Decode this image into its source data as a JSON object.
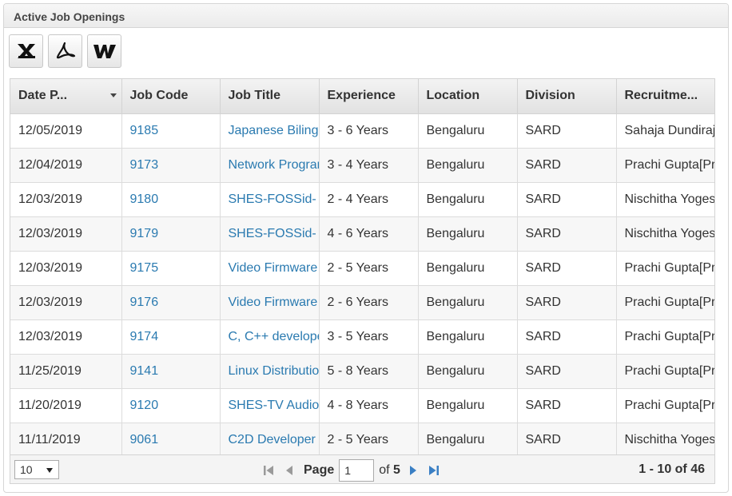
{
  "panel": {
    "title": "Active Job Openings"
  },
  "toolbar": {
    "exports": [
      {
        "name": "excel-export-button",
        "icon": "excel-icon"
      },
      {
        "name": "pdf-export-button",
        "icon": "pdf-icon"
      },
      {
        "name": "word-export-button",
        "icon": "word-icon"
      }
    ]
  },
  "table": {
    "columns": [
      "Date P...",
      "Job Code",
      "Job Title",
      "Experience",
      "Location",
      "Division",
      "Recruitme..."
    ],
    "rows": [
      [
        "12/05/2019",
        "9185",
        "Japanese Bilingual",
        "3 - 6 Years",
        "Bengaluru",
        "SARD",
        "Sahaja Dundiraj"
      ],
      [
        "12/04/2019",
        "9173",
        "Network Programmer",
        "3 - 4 Years",
        "Bengaluru",
        "SARD",
        "Prachi Gupta[Pr"
      ],
      [
        "12/03/2019",
        "9180",
        "SHES-FOSSid-",
        "2 - 4 Years",
        "Bengaluru",
        "SARD",
        "Nischitha Yogesh"
      ],
      [
        "12/03/2019",
        "9179",
        "SHES-FOSSid-",
        "4 - 6 Years",
        "Bengaluru",
        "SARD",
        "Nischitha Yogesh"
      ],
      [
        "12/03/2019",
        "9175",
        "Video Firmware",
        "2 - 5 Years",
        "Bengaluru",
        "SARD",
        "Prachi Gupta[Pr"
      ],
      [
        "12/03/2019",
        "9176",
        "Video Firmware",
        "2 - 6 Years",
        "Bengaluru",
        "SARD",
        "Prachi Gupta[Pr"
      ],
      [
        "12/03/2019",
        "9174",
        "C, C++ developer",
        "3 - 5 Years",
        "Bengaluru",
        "SARD",
        "Prachi Gupta[Pr"
      ],
      [
        "11/25/2019",
        "9141",
        "Linux Distribution",
        "5 - 8 Years",
        "Bengaluru",
        "SARD",
        "Prachi Gupta[Pr"
      ],
      [
        "11/20/2019",
        "9120",
        "SHES-TV Audio",
        "4 - 8 Years",
        "Bengaluru",
        "SARD",
        "Prachi Gupta[Pr"
      ],
      [
        "11/11/2019",
        "9061",
        "C2D Developer",
        "2 - 5 Years",
        "Bengaluru",
        "SARD",
        "Nischitha Yogesh"
      ]
    ]
  },
  "pager": {
    "page_size": "10",
    "page_label": "Page",
    "current_page": "1",
    "of_label": "of",
    "total_pages": "5",
    "range_text": "1 - 10 of 46"
  },
  "colors": {
    "link": "#2a7ab0",
    "nav_arrow": "#3a7fc4"
  }
}
